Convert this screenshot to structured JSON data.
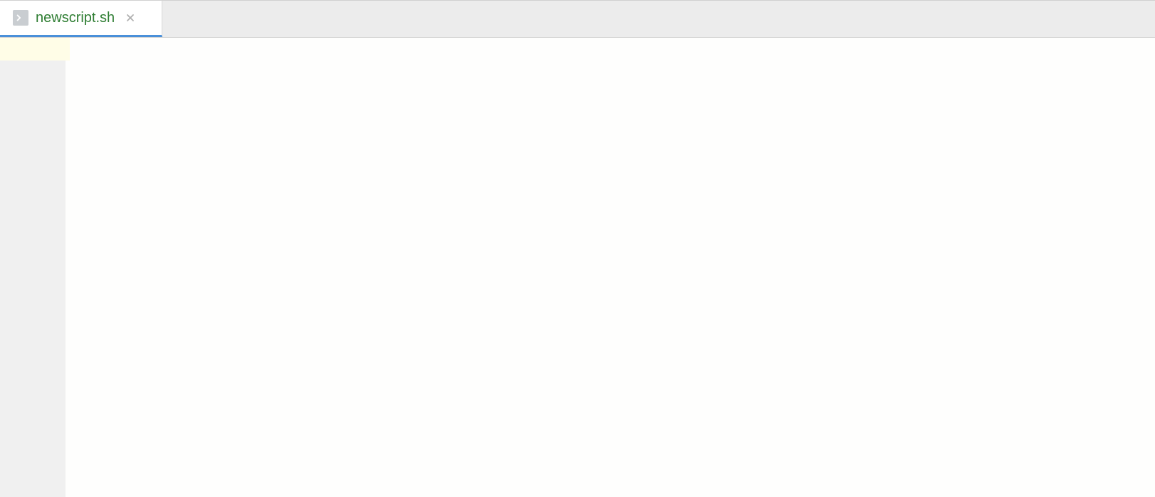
{
  "tabs": [
    {
      "label": "newscript.sh",
      "icon": "terminal-icon",
      "active": true
    }
  ],
  "editor": {
    "content": ""
  }
}
